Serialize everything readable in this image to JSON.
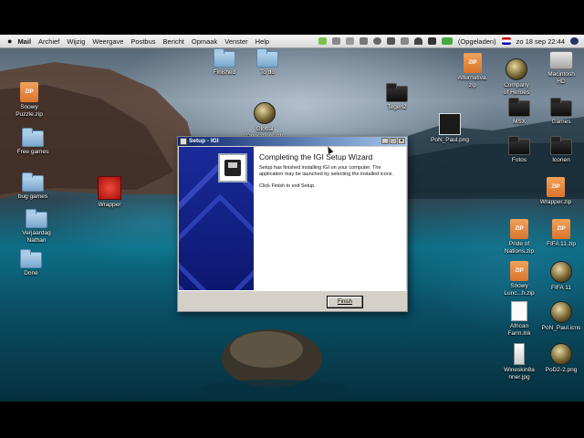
{
  "menubar": {
    "apple": "",
    "items": [
      "Mail",
      "Archief",
      "Wijzig",
      "Weergave",
      "Postbus",
      "Bericht",
      "Opmaak",
      "Venster",
      "Help"
    ],
    "battery_status": "(Opgeladen)",
    "datetime": "zo 18 sep  22:44"
  },
  "desktop_icons": [
    {
      "label": "Finished",
      "type": "folder"
    },
    {
      "label": "To do",
      "type": "folder"
    },
    {
      "label": "Alternativa.\nzip",
      "type": "zip"
    },
    {
      "label": "Company\nof Heroes",
      "type": "round"
    },
    {
      "label": "Macintosh\nHD",
      "type": "disk"
    },
    {
      "label": "Snowy\nPuzzle.zip",
      "type": "zip"
    },
    {
      "label": "Tegen2",
      "type": "blackfolder"
    },
    {
      "label": "MSX",
      "type": "blackfolder"
    },
    {
      "label": "Games",
      "type": "blackfolder"
    },
    {
      "label": "Global\nOperations.gb",
      "type": "round"
    },
    {
      "label": "PoN_Paul.png",
      "type": "square"
    },
    {
      "label": "Free games",
      "type": "folder"
    },
    {
      "label": "Fotos",
      "type": "blackfolder"
    },
    {
      "label": "Iconen",
      "type": "blackfolder"
    },
    {
      "label": "bug games",
      "type": "folder"
    },
    {
      "label": "Wrapper",
      "type": "red"
    },
    {
      "label": "Wrapper.zip",
      "type": "zip"
    },
    {
      "label": "Verjaardag\nNathan",
      "type": "folder"
    },
    {
      "label": "Pride of\nNations.zip",
      "type": "zip"
    },
    {
      "label": "FIFA 11.zip",
      "type": "zip"
    },
    {
      "label": "Done",
      "type": "folder"
    },
    {
      "label": "Snowy\nLunc...h.zip",
      "type": "zip"
    },
    {
      "label": "FIFA 11",
      "type": "round"
    },
    {
      "label": "African\nFarm.lnk",
      "type": "doc"
    },
    {
      "label": "PoN_Paul.icns",
      "type": "round"
    },
    {
      "label": "Wineskin8a\nnner.jpg",
      "type": "tall"
    },
    {
      "label": "PoD2-2.png",
      "type": "round"
    }
  ],
  "dialog": {
    "title": "Setup - IGI",
    "heading": "Completing the IGI Setup Wizard",
    "text1": "Setup has finished installing IGI on your computer. The application may be launched by selecting the installed icons.",
    "text2": "Click Finish to exit Setup.",
    "finish_label": "Finish"
  }
}
